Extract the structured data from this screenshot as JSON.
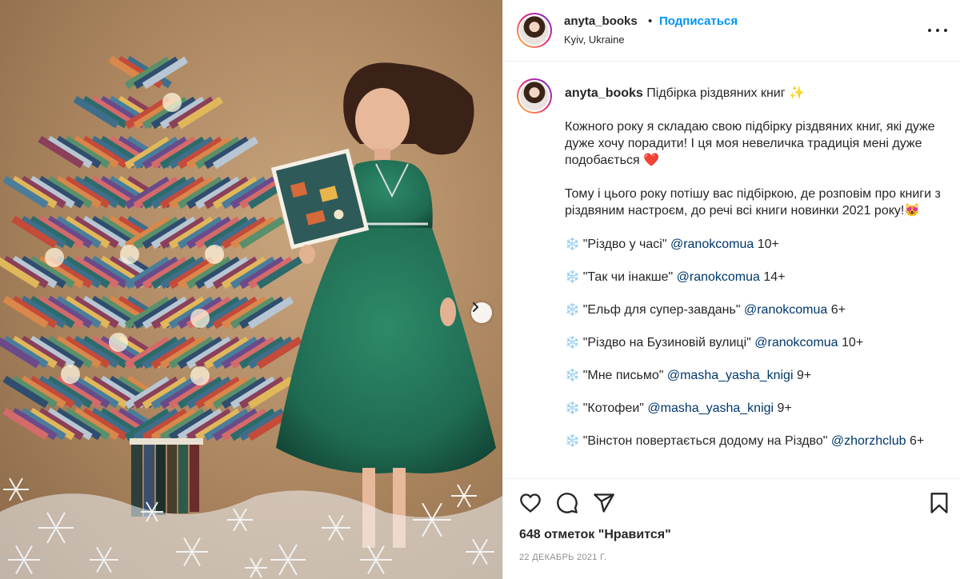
{
  "post": {
    "username": "anyta_books",
    "separator": "•",
    "follow_label": "Подписаться",
    "location": "Kyiv, Ukraine"
  },
  "caption": {
    "title": "Підбірка різдвяних книг ✨",
    "paragraph1": "Кожного року я складаю свою підбірку різдвяних книг, які дуже дуже хочу порадити! І ця моя невеличка традиція мені дуже подобається",
    "heart": "❤️",
    "paragraph2": "Тому і цього року потішу вас підбіркою, де розповім про книги з різдвяним настроєм, до речі всі книги новинки 2021 року!",
    "paragraph2_emoji": "😻",
    "bullet": "❄️",
    "books": [
      {
        "title": "\"Різдво у часі\"",
        "mention": "@ranokcomua",
        "age": "10+"
      },
      {
        "title": "\"Так чи інакше\"",
        "mention": "@ranokcomua",
        "age": "14+"
      },
      {
        "title": "\"Ельф для супер-завдань\"",
        "mention": "@ranokcomua",
        "age": "6+"
      },
      {
        "title": "\"Різдво на Бузиновій вулиці\"",
        "mention": "@ranokcomua",
        "age": "10+"
      },
      {
        "title": "\"Мне письмо\"",
        "mention": "@masha_yasha_knigi",
        "age": "9+"
      },
      {
        "title": "\"Котофеи\"",
        "mention": "@masha_yasha_knigi",
        "age": "9+"
      },
      {
        "title": "\"Вінстон повертається додому на Різдво\"",
        "mention": "@zhorzhclub",
        "age": "6+"
      }
    ]
  },
  "actions": {
    "icons": [
      "heart-icon",
      "comment-icon",
      "share-icon",
      "bookmark-icon"
    ],
    "likes_text": "648 отметок \"Нравится\"",
    "date_text": "22 ДЕКАБРЬ 2021 Г."
  },
  "colors": {
    "accent": "#0095f6",
    "mention": "#00376b",
    "text": "#262626",
    "muted": "#8e8e8e",
    "dress": "#1f6b52"
  }
}
